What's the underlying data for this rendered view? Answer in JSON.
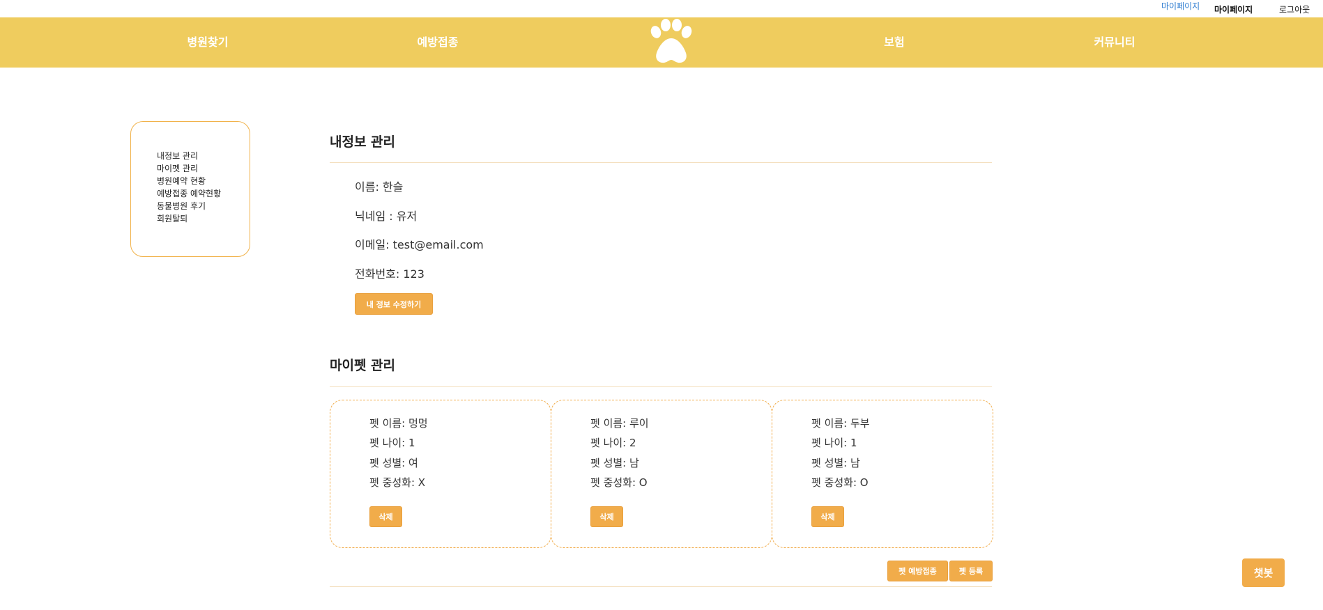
{
  "top_links": {
    "mypage_blue": "마이페이지",
    "mypage": "마이페이지",
    "logout": "로그아웃"
  },
  "nav": {
    "items": [
      "병원찾기",
      "예방접종",
      "보험",
      "커뮤니티"
    ],
    "logo_icon": "paw-icon",
    "bg_color": "#efcc5e"
  },
  "sidebar": {
    "items": [
      "내정보 관리",
      "마이펫 관리",
      "병원예약 현황",
      "예방접종 예약현황",
      "동물병원 후기",
      "회원탈퇴"
    ]
  },
  "my_info": {
    "title": "내정보 관리",
    "name": "이름: 한슬",
    "nickname": "닉네임 : 유저",
    "email": "이메일: test@email.com",
    "phone": "전화번호: 123",
    "edit_button": "내 정보 수정하기"
  },
  "my_pet": {
    "title": "마이펫 관리",
    "pets": [
      {
        "name": "펫 이름: 멍멍",
        "age": "펫 나이: 1",
        "gender": "펫 성별: 여",
        "neutered": "펫 중성화: X",
        "delete": "삭제"
      },
      {
        "name": "펫 이름: 루이",
        "age": "펫 나이: 2",
        "gender": "펫 성별: 남",
        "neutered": "펫 중성화: O",
        "delete": "삭제"
      },
      {
        "name": "펫 이름: 두부",
        "age": "펫 나이: 1",
        "gender": "펫 성별: 남",
        "neutered": "펫 중성화: O",
        "delete": "삭제"
      }
    ],
    "vaccination_button": "펫 예방접종",
    "register_button": "펫 등록"
  },
  "chatbot": "챗봇",
  "colors": {
    "accent": "#f1ac4a",
    "link_blue": "#2f7dd1"
  }
}
